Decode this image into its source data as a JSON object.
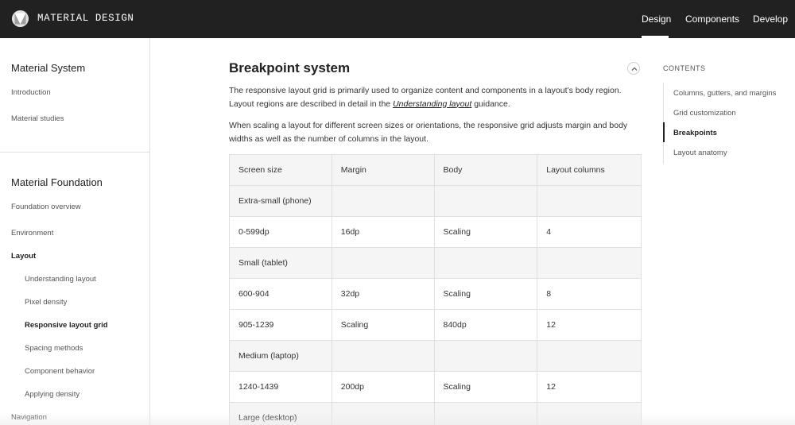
{
  "header": {
    "brand": "MATERIAL DESIGN",
    "logo_icon": "material-logo-icon",
    "nav": [
      {
        "label": "Design",
        "active": true
      },
      {
        "label": "Components",
        "active": false
      },
      {
        "label": "Develop",
        "active": false
      }
    ]
  },
  "sidebar": {
    "sections": [
      {
        "title": "Material System",
        "items": [
          {
            "label": "Introduction"
          },
          {
            "label": "Material studies"
          }
        ]
      },
      {
        "title": "Material Foundation",
        "items": [
          {
            "label": "Foundation overview"
          },
          {
            "label": "Environment"
          },
          {
            "label": "Layout",
            "active": true
          },
          {
            "label": "Understanding layout"
          },
          {
            "label": "Pixel density"
          },
          {
            "label": "Responsive layout grid",
            "active": true
          },
          {
            "label": "Spacing methods"
          },
          {
            "label": "Component behavior"
          },
          {
            "label": "Applying density"
          },
          {
            "label": "Navigation"
          }
        ]
      }
    ]
  },
  "main": {
    "title": "Breakpoint system",
    "collapse_icon": "chevron-up-icon",
    "para1_before": "The responsive layout grid is primarily used to organize content and components in a layout’s body region. Layout regions are described in detail in the ",
    "para1_link": "Understanding layout",
    "para1_after": " guidance.",
    "para2": "When scaling a layout for different screen sizes or orientations, the responsive grid adjusts margin and body widths as well as the number of columns in the layout.",
    "table": {
      "headers": [
        "Screen size",
        "Margin",
        "Body",
        "Layout columns"
      ],
      "rows": [
        [
          "Extra-small (phone)",
          "",
          "",
          ""
        ],
        [
          "0-599dp",
          "16dp",
          "Scaling",
          "4"
        ],
        [
          "Small (tablet)",
          "",
          "",
          ""
        ],
        [
          "600-904",
          "32dp",
          "Scaling",
          "8"
        ],
        [
          "905-1239",
          "Scaling",
          "840dp",
          "12"
        ],
        [
          "Medium (laptop)",
          "",
          "",
          ""
        ],
        [
          "1240-1439",
          "200dp",
          "Scaling",
          "12"
        ],
        [
          "Large (desktop)",
          "",
          "",
          ""
        ]
      ]
    }
  },
  "toc": {
    "heading": "CONTENTS",
    "items": [
      {
        "label": "Columns, gutters, and margins"
      },
      {
        "label": "Grid customization"
      },
      {
        "label": "Breakpoints",
        "active": true
      },
      {
        "label": "Layout anatomy"
      }
    ]
  },
  "colors": {
    "topbar": "#212121",
    "table_header_bg": "#f5f5f5",
    "border": "#e0e0e0"
  }
}
